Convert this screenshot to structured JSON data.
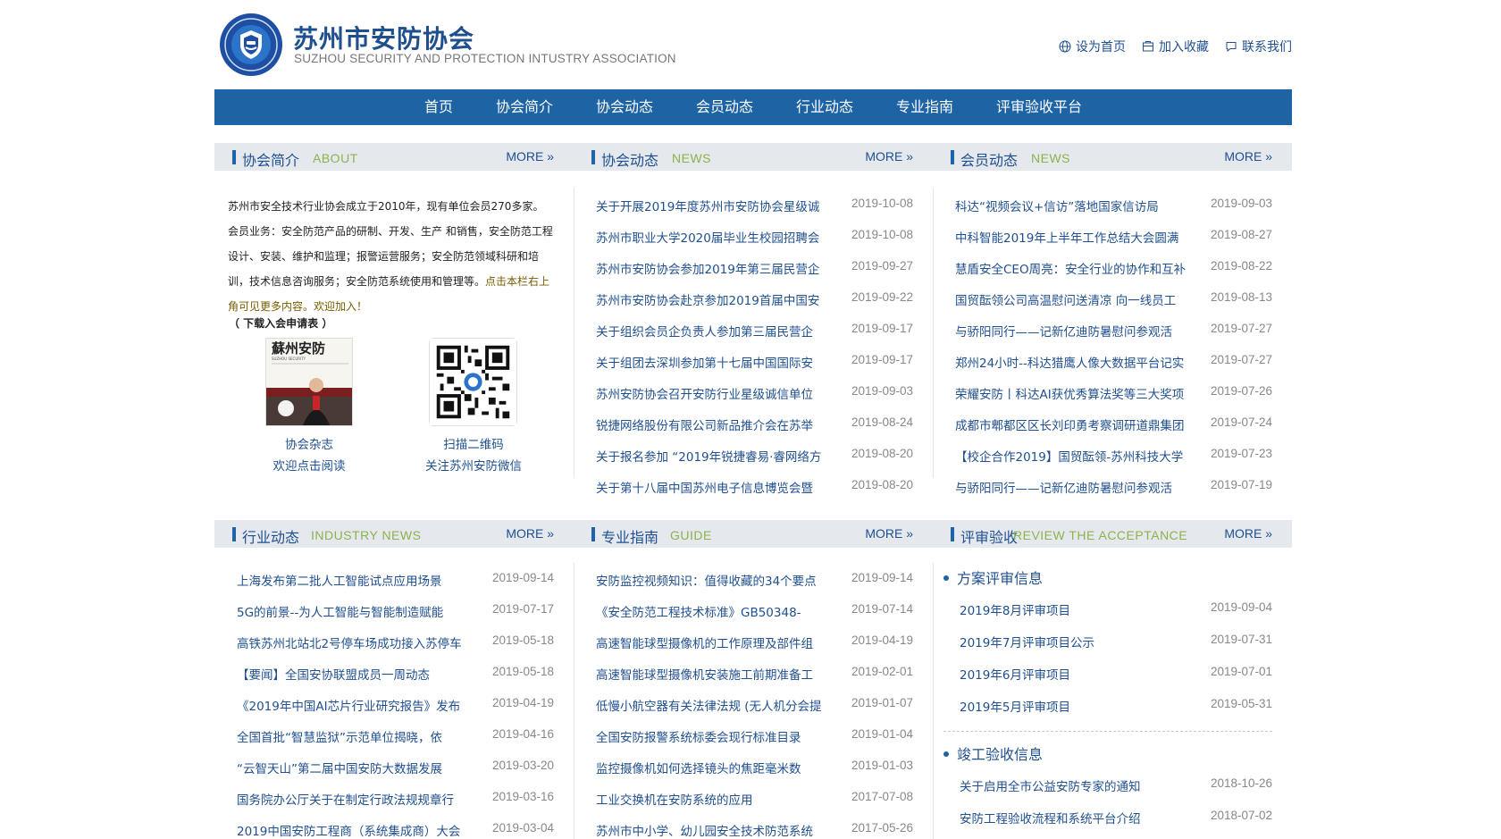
{
  "header": {
    "site_name": "苏州市安防协会",
    "site_name_en": "SUZHOU SECURITY AND PROTECTION INTUSTRY ASSOCIATION",
    "links": [
      {
        "label": "设为首页",
        "icon": "globe-icon"
      },
      {
        "label": "加入收藏",
        "icon": "bookmark-icon"
      },
      {
        "label": "联系我们",
        "icon": "chat-icon"
      }
    ]
  },
  "nav": [
    "首页",
    "协会简介",
    "协会动态",
    "会员动态",
    "行业动态",
    "专业指南",
    "评审验收平台"
  ],
  "more_label": "MORE »",
  "about": {
    "title": "协会简介",
    "title_en": "ABOUT",
    "text_main": "苏州市安全技术行业协会成立于2010年，现有单位会员270多家。会员业务：安全防范产品的研制、开发、生产 和销售，安全防范工程设计、安装、维护和监理；报警运营服务；安全防范领域科研和培训，技术信息咨询服务；安全防范系统使用和管理等。",
    "text_highlight": "点击本栏右上角可见更多内容。欢迎加入！",
    "download": "（ 下载入会申请表 ）",
    "magazine_caption": [
      "协会杂志",
      "欢迎点击阅读"
    ],
    "magazine_cover_title": "蘇州安防",
    "magazine_cover_en": "SUZHOU SECURITY",
    "qr_caption": [
      "扫描二维码",
      "关注苏州安防微信"
    ]
  },
  "assoc_news": {
    "title": "协会动态",
    "title_en": "NEWS",
    "items": [
      {
        "title": "关于开展2019年度苏州市安防协会星级诚",
        "date": "2019-10-08"
      },
      {
        "title": "苏州市职业大学2020届毕业生校园招聘会",
        "date": "2019-10-08"
      },
      {
        "title": "苏州市安防协会参加2019年第三届民营企",
        "date": "2019-09-27"
      },
      {
        "title": "苏州市安防协会赴京参加2019首届中国安",
        "date": "2019-09-22"
      },
      {
        "title": "关于组织会员企负责人参加第三届民营企",
        "date": "2019-09-17"
      },
      {
        "title": "关于组团去深圳参加第十七届中国国际安",
        "date": "2019-09-17"
      },
      {
        "title": "苏州安防协会召开安防行业星级诚信单位",
        "date": "2019-09-03"
      },
      {
        "title": "锐捷网络股份有限公司新品推介会在苏举",
        "date": "2019-08-24"
      },
      {
        "title": "关于报名参加 “2019年锐捷睿易·睿网络方",
        "date": "2019-08-20"
      },
      {
        "title": "关于第十八届中国苏州电子信息博览会暨",
        "date": "2019-08-20"
      }
    ]
  },
  "member_news": {
    "title": "会员动态",
    "title_en": "NEWS",
    "items": [
      {
        "title": "科达“视频会议+信访”落地国家信访局",
        "date": "2019-09-03"
      },
      {
        "title": "中科智能2019年上半年工作总结大会圆满",
        "date": "2019-08-27"
      },
      {
        "title": "慧盾安全CEO周亮：安全行业的协作和互补",
        "date": "2019-08-22"
      },
      {
        "title": "国贸酝领公司高温慰问送清凉 向一线员工",
        "date": "2019-08-13"
      },
      {
        "title": "与骄阳同行——记新亿迪防暑慰问参观活",
        "date": "2019-07-27"
      },
      {
        "title": "郑州24小时--科达猎鹰人像大数据平台记实",
        "date": "2019-07-27"
      },
      {
        "title": "荣耀安防丨科达AI获优秀算法奖等三大奖项",
        "date": "2019-07-26"
      },
      {
        "title": "成都市郫都区区长刘印勇考察调研道鼎集团",
        "date": "2019-07-24"
      },
      {
        "title": "【校企合作2019】国贸酝领-苏州科技大学",
        "date": "2019-07-23"
      },
      {
        "title": "与骄阳同行——记新亿迪防暑慰问参观活",
        "date": "2019-07-19"
      }
    ]
  },
  "industry_news": {
    "title": "行业动态",
    "title_en": "INDUSTRY NEWS",
    "items": [
      {
        "title": "上海发布第二批人工智能试点应用场景",
        "date": "2019-09-14"
      },
      {
        "title": "5G的前景--为人工智能与智能制造赋能",
        "date": "2019-07-17"
      },
      {
        "title": "高铁苏州北站北2号停车场成功接入苏停车",
        "date": "2019-05-18"
      },
      {
        "title": "【要闻】全国安协联盟成员一周动态",
        "date": "2019-05-18"
      },
      {
        "title": "《2019年中国AI芯片行业研究报告》发布",
        "date": "2019-04-19"
      },
      {
        "title": "全国首批“智慧监狱”示范单位揭晓，依",
        "date": "2019-04-16"
      },
      {
        "title": "“云智天山”第二届中国安防大数据发展",
        "date": "2019-03-20"
      },
      {
        "title": "国务院办公厅关于在制定行政法规规章行",
        "date": "2019-03-16"
      },
      {
        "title": "2019中国安防工程商（系统集成商）大会",
        "date": "2019-03-04"
      }
    ]
  },
  "guide": {
    "title": "专业指南",
    "title_en": "GUIDE",
    "items": [
      {
        "title": "安防监控视频知识：值得收藏的34个要点",
        "date": "2019-09-14"
      },
      {
        "title": "《安全防范工程技术标准》GB50348-",
        "date": "2019-07-14"
      },
      {
        "title": "高速智能球型摄像机的工作原理及部件组",
        "date": "2019-04-19"
      },
      {
        "title": "高速智能球型摄像机安装施工前期准备工",
        "date": "2019-02-01"
      },
      {
        "title": "低慢小航空器有关法律法规 (无人机分会提",
        "date": "2019-01-07"
      },
      {
        "title": "全国安防报警系统标委会现行标准目录",
        "date": "2019-01-04"
      },
      {
        "title": "监控摄像机如何选择镜头的焦距毫米数",
        "date": "2019-01-03"
      },
      {
        "title": "工业交换机在安防系统的应用",
        "date": "2017-07-08"
      },
      {
        "title": "苏州市中小学、幼儿园安全技术防范系统",
        "date": "2017-05-26"
      }
    ]
  },
  "review": {
    "title": "评审验收",
    "title_en": "REVIEW THE ACCEPTANCE",
    "plan_title": "方案评审信息",
    "plan_items": [
      {
        "title": "2019年8月评审项目",
        "date": "2019-09-04"
      },
      {
        "title": "2019年7月评审项目公示",
        "date": "2019-07-31"
      },
      {
        "title": "2019年6月评审项目",
        "date": "2019-07-01"
      },
      {
        "title": "2019年5月评审项目",
        "date": "2019-05-31"
      }
    ],
    "accept_title": "竣工验收信息",
    "accept_items": [
      {
        "title": "关于启用全市公益安防专家的通知",
        "date": "2018-10-26"
      },
      {
        "title": "安防工程验收流程和系统平台介绍",
        "date": "2018-07-02"
      }
    ]
  },
  "colors": {
    "brand": "#1e63a4",
    "link": "#1f4f8f",
    "accent_en": "#8cb24c",
    "section_bg": "#e5e9ee"
  }
}
